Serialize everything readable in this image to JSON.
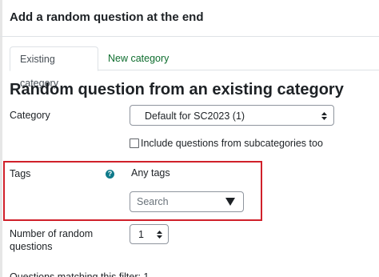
{
  "header": {
    "title": "Add a random question at the end"
  },
  "tabs": [
    {
      "label": "Existing category",
      "active": true
    },
    {
      "label": "New category",
      "active": false
    }
  ],
  "section_title": "Random question from an existing category",
  "category": {
    "label": "Category",
    "value": "Default for SC2023 (1)"
  },
  "subcategories": {
    "label": "Include questions from subcategories too",
    "checked": false
  },
  "tags": {
    "label": "Tags",
    "help_icon": "question-circle",
    "value": "Any tags",
    "search_placeholder": "Search",
    "dropdown_icon": "triangle-down"
  },
  "random_count": {
    "label_line1": "Number of random",
    "label_line2": "questions",
    "value": "1"
  },
  "footer_text": "Questions matching this filter: 1",
  "colors": {
    "highlight": "#d0202a",
    "link": "#0f6e2f",
    "help_icon": "#0f7a8a"
  }
}
